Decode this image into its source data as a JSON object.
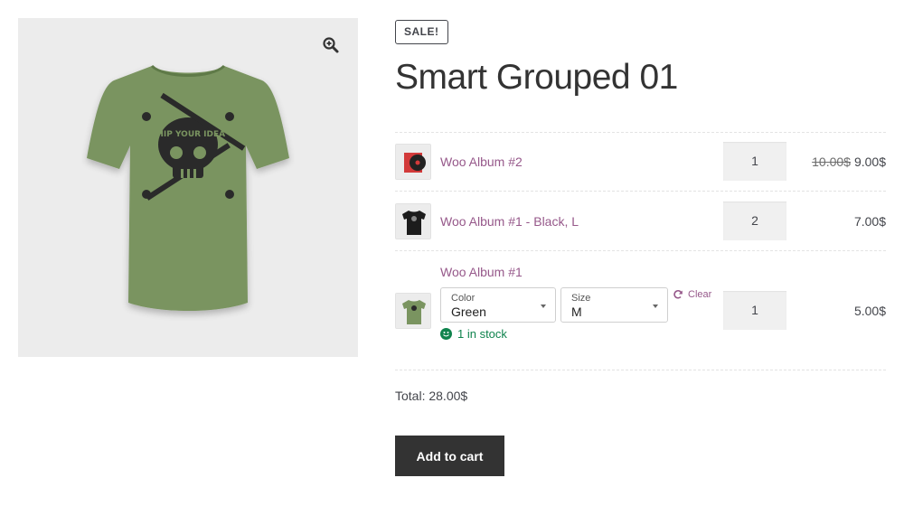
{
  "product": {
    "sale_badge": "SALE!",
    "title": "Smart Grouped 01",
    "zoom_icon": "magnifier-plus-icon",
    "main_image": "green-tshirt-skull-print",
    "shirt_print_text": "SHIP YOUR IDEA"
  },
  "colors": {
    "link": "#96588a",
    "stock": "#0f834d",
    "button_bg": "#333333",
    "gallery_bg": "#ececec",
    "shirt": "#7a9460"
  },
  "items": [
    {
      "name": "Woo Album #2",
      "thumb": "red-album-cover",
      "quantity": "1",
      "regular_price": "10.00$",
      "price": "9.00$"
    },
    {
      "name": "Woo Album #1 - Black, L",
      "thumb": "black-tshirt",
      "quantity": "2",
      "price": "7.00$"
    },
    {
      "name": "Woo Album #1",
      "thumb": "green-tshirt",
      "quantity": "1",
      "price": "5.00$",
      "attributes": [
        {
          "label": "Color",
          "value": "Green"
        },
        {
          "label": "Size",
          "value": "M"
        }
      ],
      "clear_label": "Clear",
      "stock_text": "1 in stock"
    }
  ],
  "total_text": "Total: 28.00$",
  "add_to_cart_label": "Add to cart"
}
